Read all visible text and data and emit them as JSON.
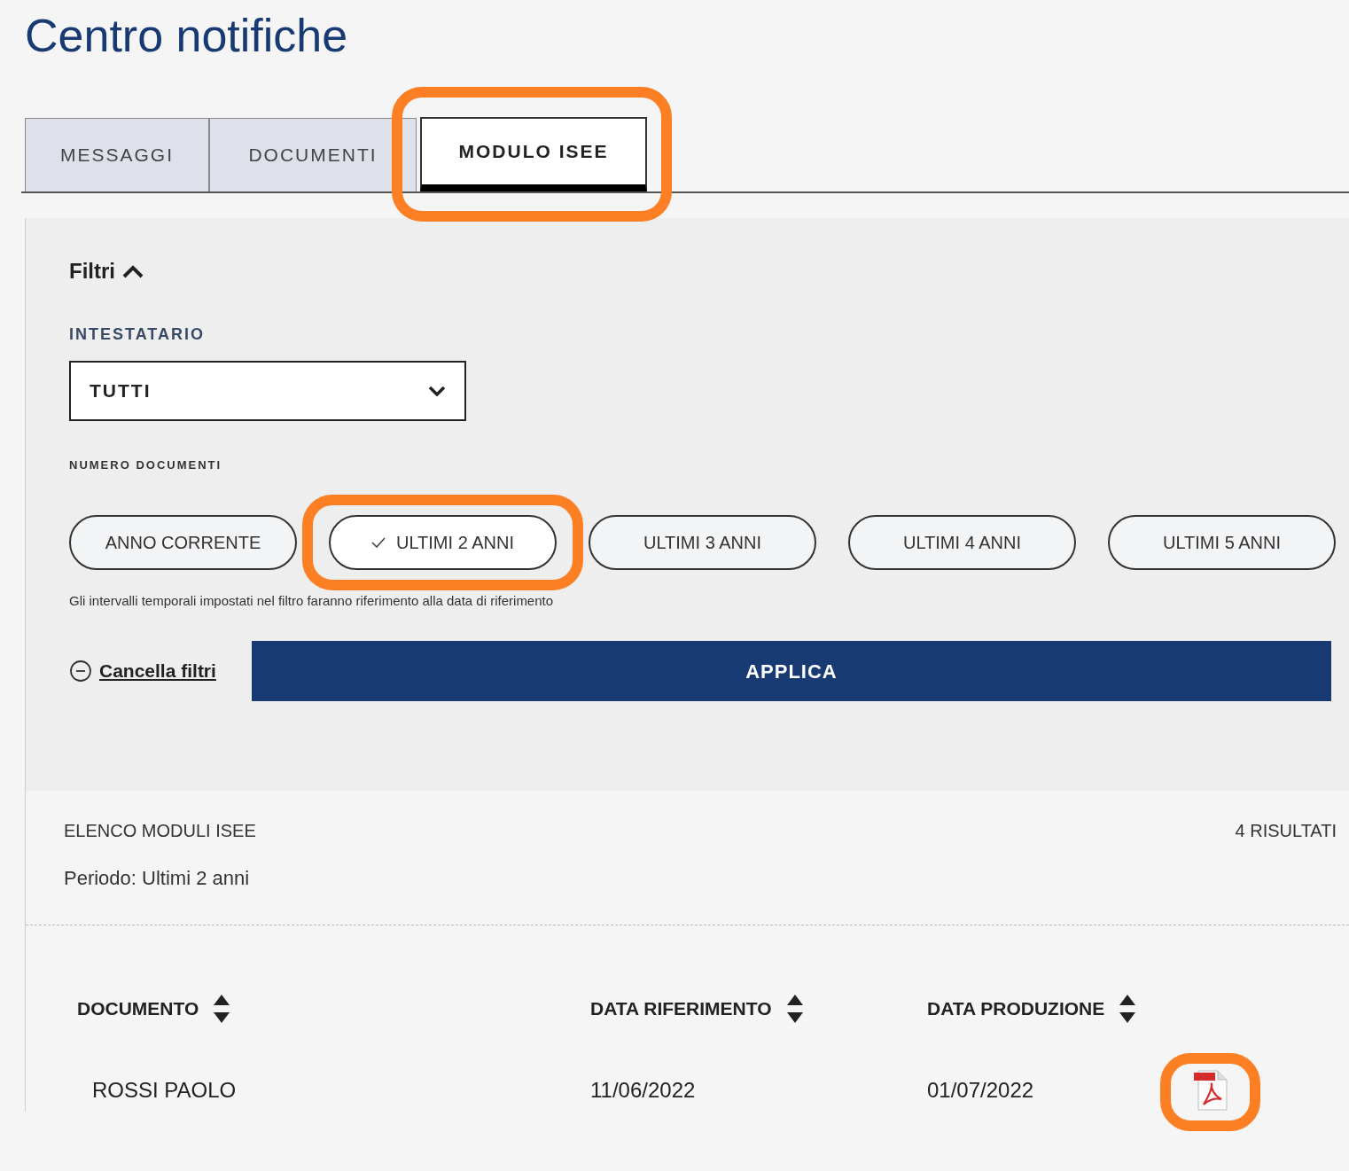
{
  "page_title": "Centro notifiche",
  "tabs": [
    {
      "label": "MESSAGGI",
      "selected": false,
      "highlighted": false
    },
    {
      "label": "DOCUMENTI",
      "selected": false,
      "highlighted": false
    },
    {
      "label": "MODULO ISEE",
      "selected": true,
      "highlighted": true
    }
  ],
  "filters": {
    "title": "Filtri",
    "expanded": true,
    "holder": {
      "label": "INTESTATARIO",
      "value": "TUTTI"
    },
    "count_label": "NUMERO DOCUMENTI",
    "periods": [
      {
        "label": "ANNO CORRENTE",
        "selected": false,
        "highlighted": false
      },
      {
        "label": "ULTIMI 2 ANNI",
        "selected": true,
        "highlighted": true
      },
      {
        "label": "ULTIMI 3 ANNI",
        "selected": false,
        "highlighted": false
      },
      {
        "label": "ULTIMI 4 ANNI",
        "selected": false,
        "highlighted": false
      },
      {
        "label": "ULTIMI 5 ANNI",
        "selected": false,
        "highlighted": false
      }
    ],
    "note": "Gli intervalli temporali impostati nel filtro faranno riferimento alla data di riferimento",
    "clear_link": "Cancella filtri",
    "apply_button": "APPLICA"
  },
  "list": {
    "title": "ELENCO MODULI ISEE",
    "count": "4 RISULTATI",
    "period": "Periodo: Ultimi 2 anni",
    "columns": [
      "DOCUMENTO",
      "DATA RIFERIMENTO",
      "DATA PRODUZIONE"
    ],
    "rows": [
      {
        "cells": [
          "ROSSI PAOLO",
          "11/06/2022",
          "01/07/2022"
        ],
        "highlighted": true
      }
    ]
  }
}
